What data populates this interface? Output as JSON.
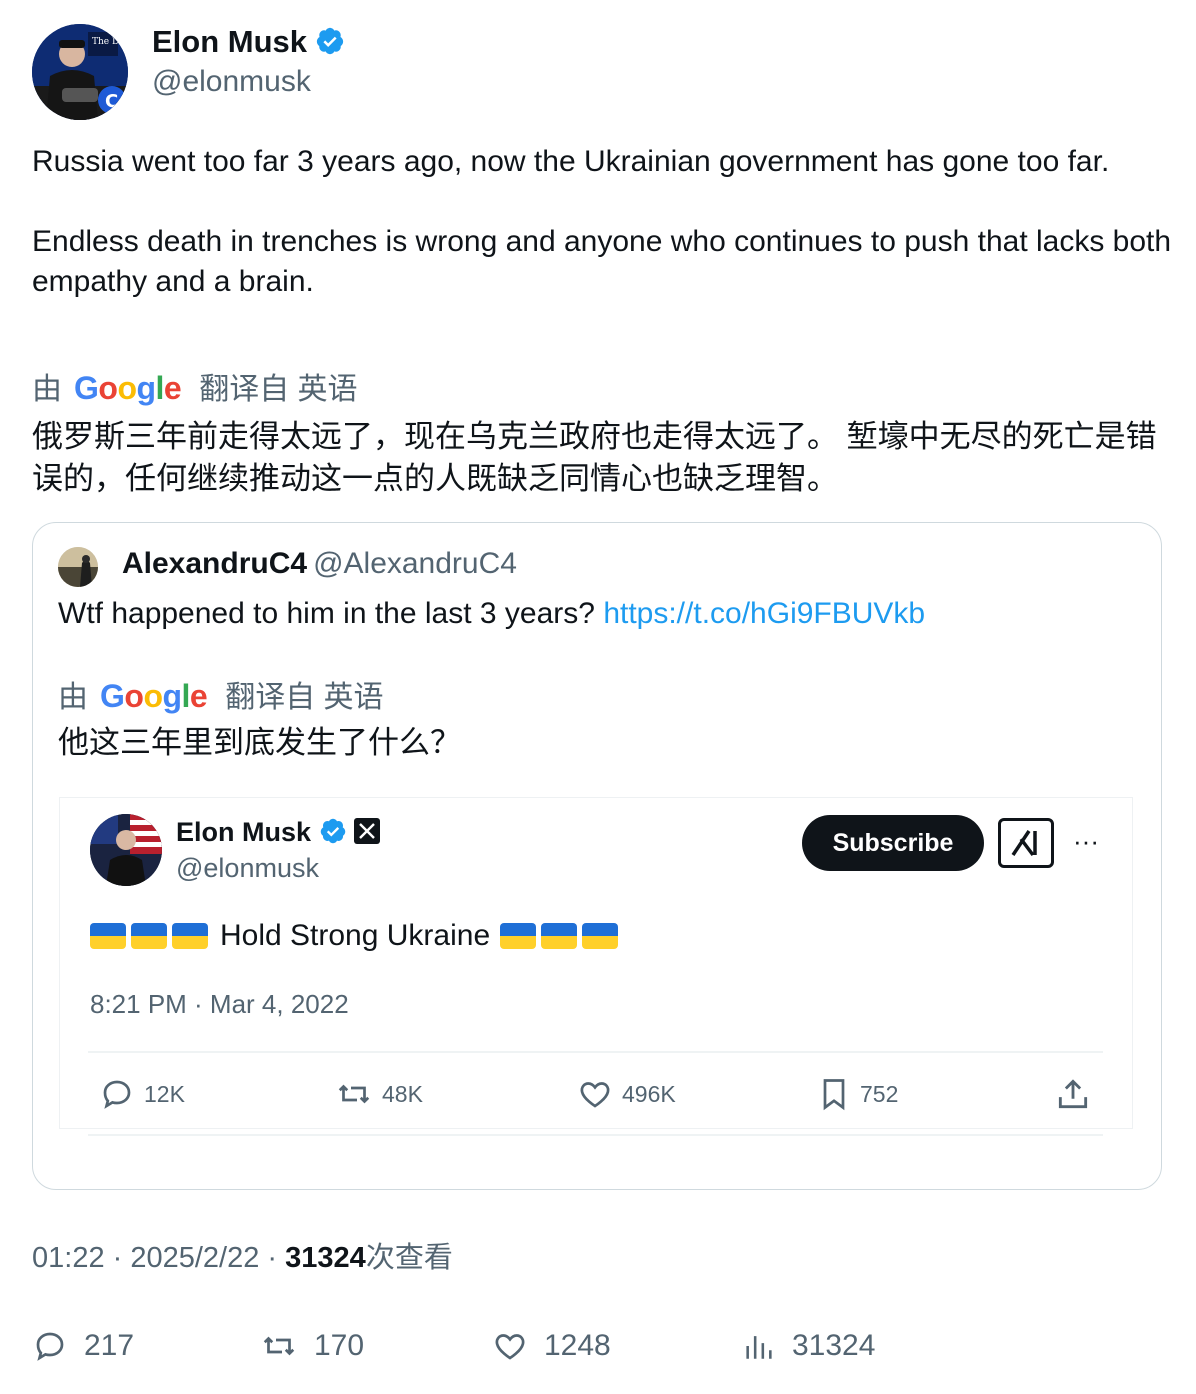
{
  "author": {
    "name": "Elon Musk",
    "handle": "@elonmusk",
    "avatar_badge_text": "The Dogefa"
  },
  "tweet": {
    "paragraph1": "Russia went too far 3 years ago, now the Ukrainian government has gone too far.",
    "paragraph2": "Endless death in trenches is wrong and anyone who continues to push that lacks both empathy and a brain."
  },
  "translation": {
    "prefix": "由",
    "provider": "Google",
    "suffix": "翻译自 英语",
    "text": "俄罗斯三年前走得太远了，现在乌克兰政府也走得太远了。 堑壕中无尽的死亡是错误的，任何继续推动这一点的人既缺乏同情心也缺乏理智。"
  },
  "quote": {
    "name": "AlexandruC4",
    "handle": "@AlexandruC4",
    "text": "Wtf happened to him in the last 3 years?",
    "link": "https://t.co/hGi9FBUVkb",
    "translation_prefix": "由",
    "translation_provider": "Google",
    "translation_suffix": "翻译自 英语",
    "translation_text": "他这三年里到底发生了什么？"
  },
  "embedded": {
    "name": "Elon Musk",
    "handle": "@elonmusk",
    "subscribe_label": "Subscribe",
    "more_label": "···",
    "text": "Hold Strong Ukraine",
    "timestamp": "8:21 PM · Mar 4, 2022",
    "replies": "12K",
    "reposts": "48K",
    "likes": "496K",
    "bookmarks": "752"
  },
  "meta": {
    "time": "01:22",
    "separator": " · ",
    "date": "2025/2/22",
    "views": "31324",
    "views_suffix": "次查看"
  },
  "actions": {
    "replies": "217",
    "reposts": "170",
    "likes": "1248",
    "views": "31324"
  },
  "colors": {
    "accent": "#1d9bf0",
    "secondary_text": "#536471",
    "flag_blue": "#1f6fd6",
    "flag_yellow": "#ffd02a"
  }
}
